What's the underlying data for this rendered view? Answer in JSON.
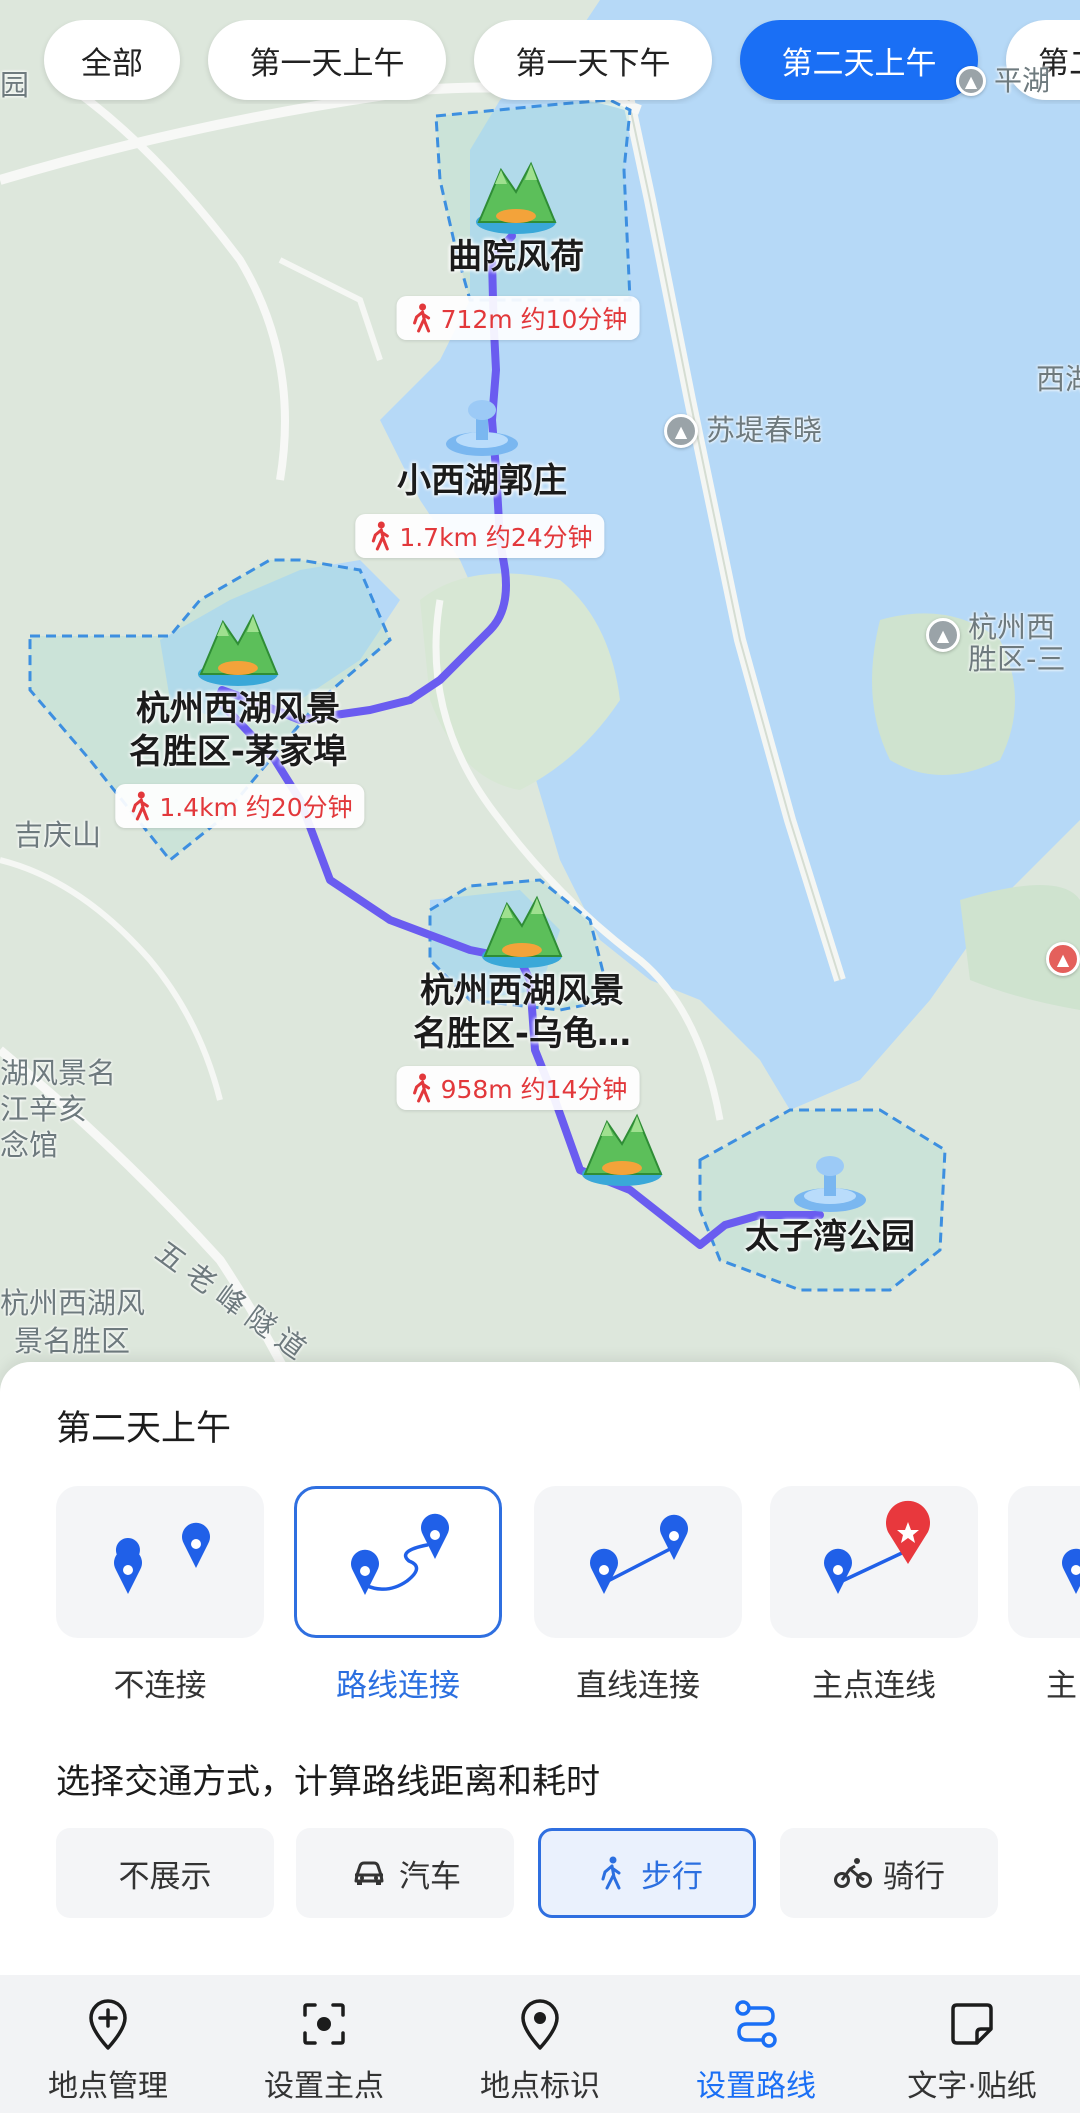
{
  "chips": [
    {
      "label": "全部",
      "active": false
    },
    {
      "label": "第一天上午",
      "active": false
    },
    {
      "label": "第一天下午",
      "active": false
    },
    {
      "label": "第二天上午",
      "active": true
    },
    {
      "label": "第二",
      "active": false
    }
  ],
  "map": {
    "labels": {
      "label_yuan": "园",
      "label_xihu_right": "西湖",
      "label_jiqingshan": "吉庆山",
      "label_hufengjing_1": "湖风景名",
      "label_hufengjing_2": "江辛亥",
      "label_hufengjing_3": "念馆",
      "label_tunnel": "五老峰隧道",
      "label_hz_scenic_1": "杭州西湖风",
      "label_hz_scenic_2": "景名胜区"
    },
    "pois": {
      "sudi": "苏堤春晓",
      "right_scenic_1": "杭州西",
      "right_scenic_2": "胜区-三",
      "top_right": "平湖"
    },
    "places": {
      "quyuan": "曲院风荷",
      "xiaoxihu": "小西湖郭庄",
      "maojiabu_1": "杭州西湖风景",
      "maojiabu_2": "名胜区-茅家埠",
      "wugui_1": "杭州西湖风景",
      "wugui_2": "名胜区-乌龟…",
      "taiziwan": "太子湾公园"
    },
    "segments": {
      "seg1": "712m 约10分钟",
      "seg2": "1.7km 约24分钟",
      "seg3": "1.4km 约20分钟",
      "seg4": "958m 约14分钟"
    },
    "colors": {
      "route": "#6a5cf0",
      "water": "#b6d9f7",
      "green": "#cfe3cf",
      "boundary": "#3d8fe0"
    }
  },
  "sheet": {
    "title": "第二天上午",
    "connections": [
      {
        "label": "不连接",
        "icon": "pins-unconnected-icon",
        "active": false
      },
      {
        "label": "路线连接",
        "icon": "pins-route-icon",
        "active": true
      },
      {
        "label": "直线连接",
        "icon": "pins-straight-icon",
        "active": false
      },
      {
        "label": "主点连线",
        "icon": "pins-main-point-icon",
        "active": false
      },
      {
        "label": "主",
        "icon": "pins-partial-icon",
        "active": false
      }
    ],
    "transport_title": "选择交通方式，计算路线距离和耗时",
    "modes": [
      {
        "label": "不展示",
        "active": false
      },
      {
        "label": "汽车",
        "icon": "car-icon",
        "active": false
      },
      {
        "label": "步行",
        "icon": "walk-icon",
        "active": true
      },
      {
        "label": "骑行",
        "icon": "bike-icon",
        "active": false
      }
    ],
    "accent": "#2f6fe0"
  },
  "nav": [
    {
      "label": "地点管理",
      "icon": "location-add-icon",
      "active": false
    },
    {
      "label": "设置主点",
      "icon": "focus-point-icon",
      "active": false
    },
    {
      "label": "地点标识",
      "icon": "location-pin-icon",
      "active": false
    },
    {
      "label": "设置路线",
      "icon": "route-icon",
      "active": true
    },
    {
      "label": "文字·贴纸",
      "icon": "sticker-icon",
      "active": false
    }
  ]
}
